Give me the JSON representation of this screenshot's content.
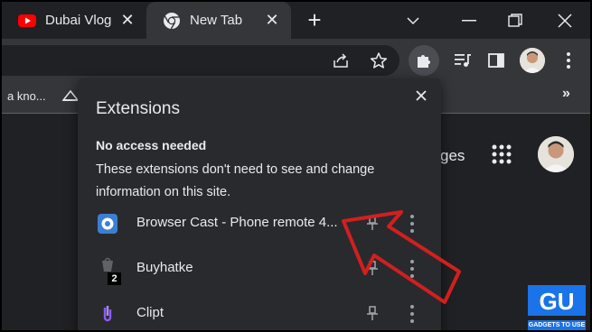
{
  "tabs": [
    {
      "label": "Dubai Vlog",
      "favicon": "youtube-icon"
    },
    {
      "label": "New Tab",
      "favicon": "chrome-icon"
    }
  ],
  "bookmarks": {
    "partial_text": "a kno..."
  },
  "page": {
    "partial_link": "ges"
  },
  "extensions_popup": {
    "title": "Extensions",
    "section_heading": "No access needed",
    "section_description": "These extensions don't need to see and change information on this site.",
    "items": [
      {
        "name": "Browser Cast - Phone remote 4...",
        "icon": "browser-cast-icon"
      },
      {
        "name": "Buyhatke",
        "icon": "buyhatke-icon",
        "badge": "2"
      },
      {
        "name": "Clipt",
        "icon": "clipt-icon"
      }
    ]
  },
  "watermark": {
    "text": "GADGETS TO USE"
  },
  "colors": {
    "background": "#202124",
    "toolbar": "#35363a",
    "popup": "#292a2d",
    "arrow": "#d21f1f"
  }
}
